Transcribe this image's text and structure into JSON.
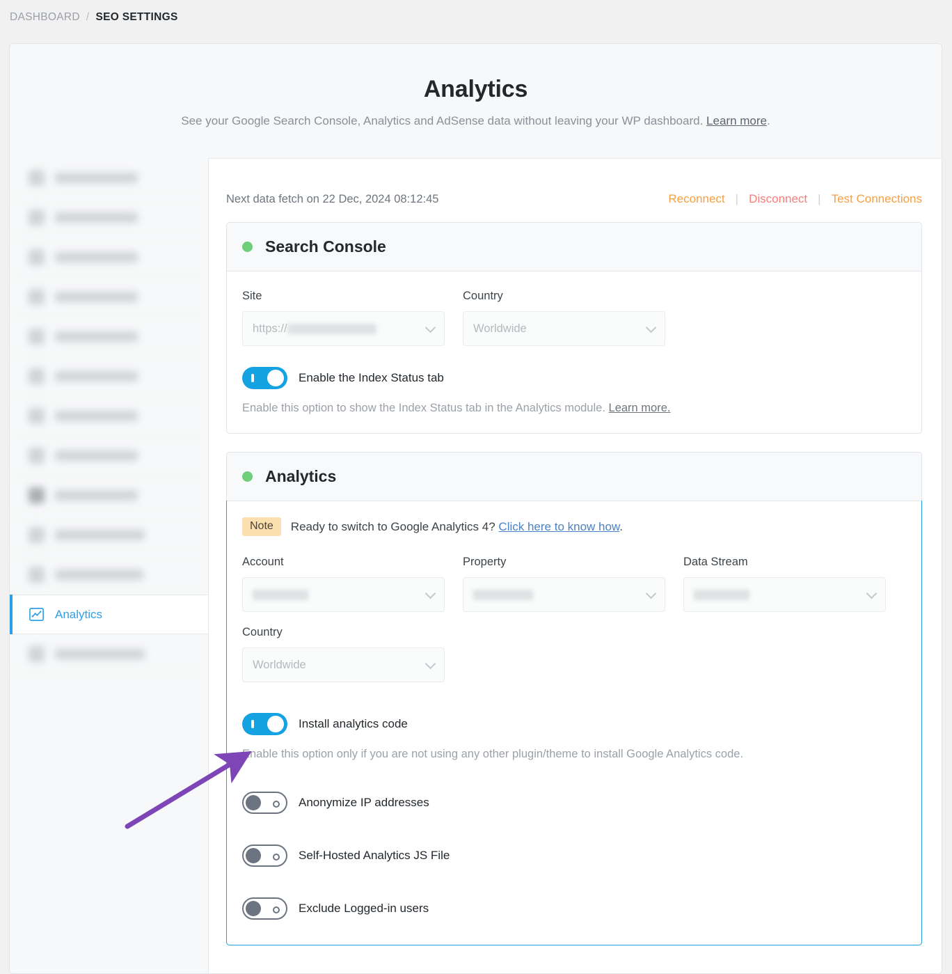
{
  "breadcrumb": {
    "root": "DASHBOARD",
    "separator": "/",
    "current": "SEO SETTINGS"
  },
  "header": {
    "title": "Analytics",
    "subtitle_before": "See your Google Search Console, Analytics and AdSense data without leaving your WP dashboard.",
    "subtitle_link": "Learn more",
    "subtitle_after": "."
  },
  "sidebar": {
    "items": [
      {
        "label": "redacted-item-1",
        "state": "blurred"
      },
      {
        "label": "redacted-item-2",
        "state": "blurred"
      },
      {
        "label": "redacted-item-3",
        "state": "blurred"
      },
      {
        "label": "redacted-item-4",
        "state": "blurred"
      },
      {
        "label": "redacted-item-5",
        "state": "blurred"
      },
      {
        "label": "redacted-item-6",
        "state": "blurred"
      },
      {
        "label": "redacted-item-7",
        "state": "blurred"
      },
      {
        "label": "redacted-item-8",
        "state": "blurred"
      },
      {
        "label": "redacted-item-9",
        "state": "blurred-dark"
      },
      {
        "label": "redacted-item-10",
        "state": "blurred"
      },
      {
        "label": "redacted-item-11",
        "state": "blurred"
      },
      {
        "label": "Analytics",
        "state": "active",
        "icon": "chart-icon"
      },
      {
        "label": "redacted-item-13",
        "state": "blurred"
      }
    ]
  },
  "content": {
    "fetch_notice": "Next data fetch on 22 Dec, 2024 08:12:45",
    "actions": {
      "reconnect": "Reconnect",
      "disconnect": "Disconnect",
      "test_connections": "Test Connections",
      "separator": "|"
    },
    "search_console": {
      "title": "Search Console",
      "status": "connected",
      "status_color": "#6ece7a",
      "fields": [
        {
          "label": "Site",
          "value": "https://",
          "redacted": true
        },
        {
          "label": "Country",
          "value": "Worldwide",
          "redacted": false
        }
      ],
      "toggle": {
        "label": "Enable the Index Status tab",
        "state": "on"
      },
      "help_text": "Enable this option to show the Index Status tab in the Analytics module.",
      "help_link": "Learn more."
    },
    "analytics": {
      "title": "Analytics",
      "status": "connected",
      "status_color": "#6ece7a",
      "note": {
        "badge": "Note",
        "text": "Ready to switch to Google Analytics 4?",
        "link": "Click here to know how",
        "suffix": "."
      },
      "fields_row1": [
        {
          "label": "Account",
          "value": "",
          "redacted": true
        },
        {
          "label": "Property",
          "value": "",
          "redacted": true
        },
        {
          "label": "Data Stream",
          "value": "",
          "redacted": true
        }
      ],
      "fields_row2": [
        {
          "label": "Country",
          "value": "Worldwide",
          "redacted": false
        }
      ],
      "toggles": [
        {
          "label": "Install analytics code",
          "state": "on",
          "help_text": "Enable this option only if you are not using any other plugin/theme to install Google Analytics code."
        },
        {
          "label": "Anonymize IP addresses",
          "state": "off"
        },
        {
          "label": "Self-Hosted Analytics JS File",
          "state": "off"
        },
        {
          "label": "Exclude Logged-in users",
          "state": "off"
        }
      ],
      "highlight_border_color": "#1e9fe0"
    }
  },
  "annotation": {
    "type": "arrow",
    "color": "#7d45b5",
    "points_to": "install-analytics-code-toggle"
  }
}
